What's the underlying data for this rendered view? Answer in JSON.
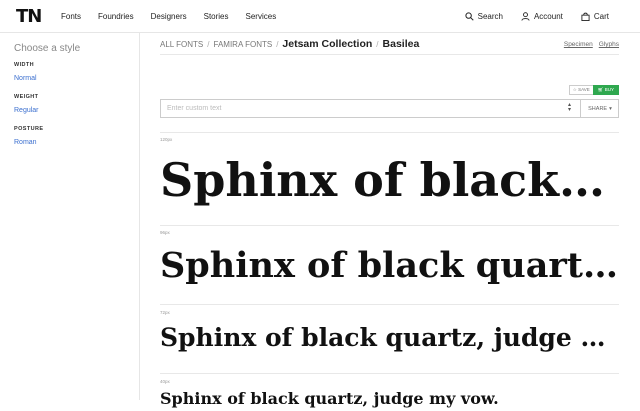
{
  "header": {
    "logo": "TN",
    "nav": [
      "Fonts",
      "Foundries",
      "Designers",
      "Stories",
      "Services"
    ],
    "search_label": "Search",
    "account_label": "Account",
    "cart_label": "Cart"
  },
  "sidebar": {
    "title": "Choose a style",
    "groups": [
      {
        "heading": "WIDTH",
        "value": "Normal"
      },
      {
        "heading": "WEIGHT",
        "value": "Regular"
      },
      {
        "heading": "POSTURE",
        "value": "Roman"
      }
    ]
  },
  "breadcrumb": {
    "items": [
      "ALL FONTS",
      "FAMIRA FONTS",
      "Jetsam Collection",
      "Basilea"
    ],
    "separator": "/"
  },
  "tabs": [
    "Specimen",
    "Glyphs"
  ],
  "actions": {
    "save": "SAVE",
    "buy": "BUY"
  },
  "custom_text": {
    "placeholder": "Enter custom text",
    "value": "",
    "share": "SHARE"
  },
  "samples": [
    {
      "size": "120px",
      "text": "Sphinx of black quartz, judge my vow."
    },
    {
      "size": "96px",
      "text": "Sphinx of black quartz, judge my vow."
    },
    {
      "size": "72px",
      "text": "Sphinx of black quartz, judge my vow."
    },
    {
      "size": "40px",
      "text": "Sphinx of black quartz, judge my vow."
    }
  ],
  "colors": {
    "accent_link": "#3b6fcf",
    "buy_green": "#2fa84f"
  }
}
